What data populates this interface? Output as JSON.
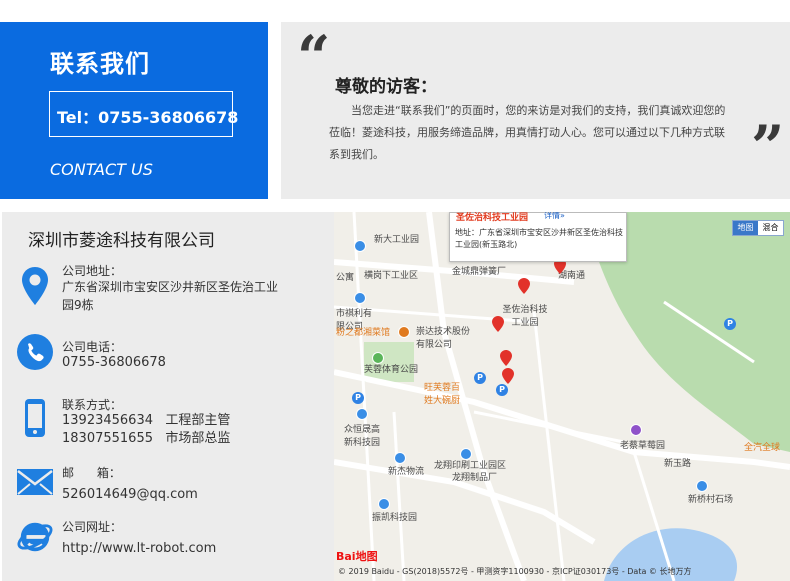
{
  "contact_box": {
    "title": "联系我们",
    "tel": "Tel：0755-36806678",
    "subtitle": "CONTACT US"
  },
  "welcome": {
    "greeting": "尊敬的访客：",
    "text": "当您走进“联系我们”的页面时，您的来访是对我们的支持，我们真诚欢迎您的莅临！菱途科技，用服务缔造品牌，用真情打动人心。您可以通过以下几种方式联系到我们。"
  },
  "company": {
    "name": "深圳市菱途科技有限公司",
    "address_label": "公司地址：",
    "address_value": "广东省深圳市宝安区沙井新区圣佐治工业园9栋",
    "phone_label": "公司电话：",
    "phone_value": "0755-36806678",
    "contact_label": "联系方式：",
    "contacts": [
      "13923456634   工程部主管",
      "18307551655   市场部总监"
    ],
    "email_label": "邮      箱：",
    "email_value": "526014649@qq.com",
    "website_label": "公司网址：",
    "website_value": "http://www.lt-robot.com"
  },
  "map": {
    "popup_title": "圣佐治科技工业园",
    "popup_detail": "详情»",
    "popup_address": "地址：广东省深圳市宝安区沙井新区圣佐治科技工业园(新玉路北)",
    "toggle_map": "地图",
    "toggle_hybrid": "混合",
    "labels": {
      "l1": "新大工业园",
      "l2": "横岗下工业区",
      "l3": "金城鼎弹簧厂",
      "l4": "公寓",
      "l5": "圣佐治科技工业园",
      "l6": "市祺利有限公司",
      "l7": "粉之都湘菜馆",
      "l8": "崇达技术股份有限公司",
      "l9": "芙蓉体育公园",
      "l10": "旺芙蓉百姓大碗厨",
      "l11": "众恒晟高新科技园",
      "l12": "龙翔印刷工业园区",
      "l13": "龙翔制品厂",
      "l14": "新杰物流",
      "l15": "振凯科技园",
      "l16": "新玉路",
      "l17": "老蔡草莓园",
      "l18": "新桥村石场",
      "l19": "全汽全球",
      "l20": "湖南通"
    },
    "footer": "© 2019 Baidu - GS(2018)5572号 - 甲测资字1100930 - 京ICP证030173号 - Data © 长地万方",
    "logo": "Bai地图"
  },
  "colors": {
    "brand_blue": "#0a6be0",
    "panel_gray": "#ececec",
    "icon_blue": "#1f7fe0"
  }
}
